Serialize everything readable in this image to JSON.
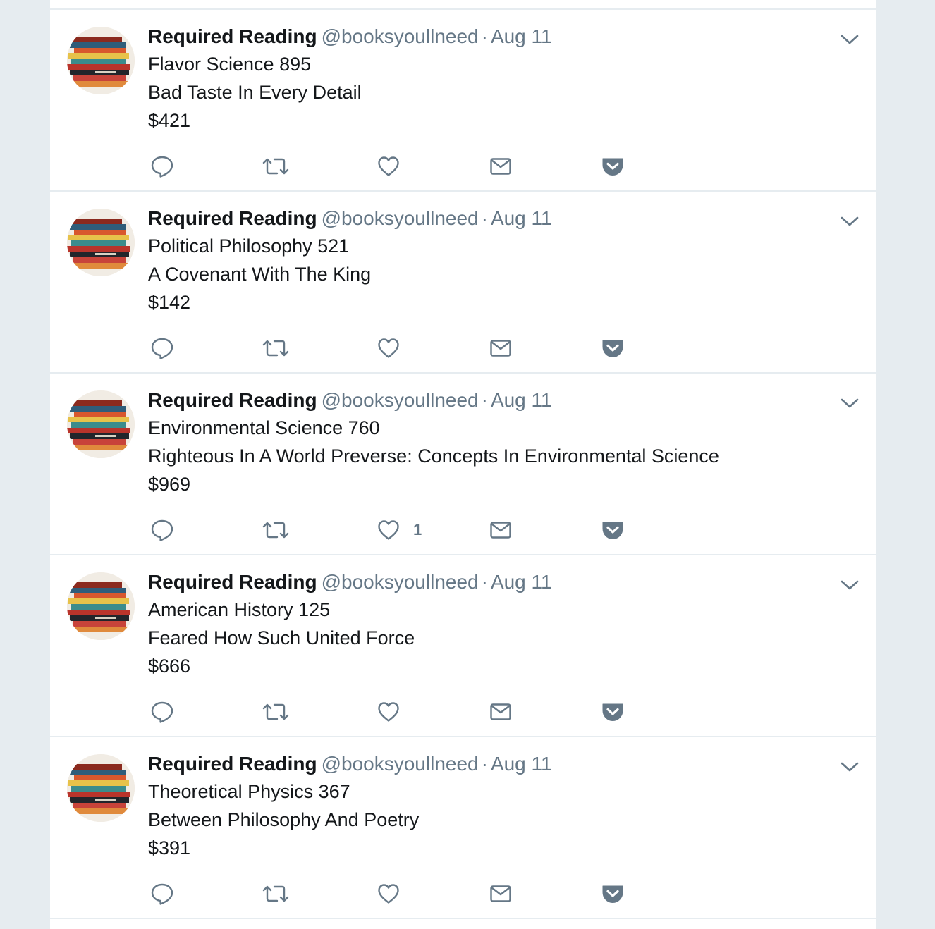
{
  "tweets": [
    {
      "author": "Required Reading",
      "handle": "@booksyoullneed",
      "separator": "·",
      "time": "Aug 11",
      "lines": [
        "Flavor Science 895",
        "Bad Taste In Every Detail",
        "$421"
      ],
      "like_count": ""
    },
    {
      "author": "Required Reading",
      "handle": "@booksyoullneed",
      "separator": "·",
      "time": "Aug 11",
      "lines": [
        "Political Philosophy 521",
        "A Covenant With The King",
        "$142"
      ],
      "like_count": ""
    },
    {
      "author": "Required Reading",
      "handle": "@booksyoullneed",
      "separator": "·",
      "time": "Aug 11",
      "lines": [
        "Environmental Science 760",
        "Righteous In A World Preverse: Concepts In Environmental Science",
        "$969"
      ],
      "like_count": "1"
    },
    {
      "author": "Required Reading",
      "handle": "@booksyoullneed",
      "separator": "·",
      "time": "Aug 11",
      "lines": [
        "American History 125",
        "Feared How Such United Force",
        "$666"
      ],
      "like_count": ""
    },
    {
      "author": "Required Reading",
      "handle": "@booksyoullneed",
      "separator": "·",
      "time": "Aug 11",
      "lines": [
        "Theoretical Physics 367",
        "Between Philosophy And Poetry",
        "$391"
      ],
      "like_count": ""
    }
  ],
  "icons": {
    "reply": "reply-icon",
    "retweet": "retweet-icon",
    "like": "heart-icon",
    "direct_message": "envelope-icon",
    "pocket": "pocket-icon",
    "more": "chevron-down-icon"
  },
  "colors": {
    "background": "#e6ecf0",
    "card": "#ffffff",
    "text": "#14171a",
    "secondary": "#657786"
  }
}
